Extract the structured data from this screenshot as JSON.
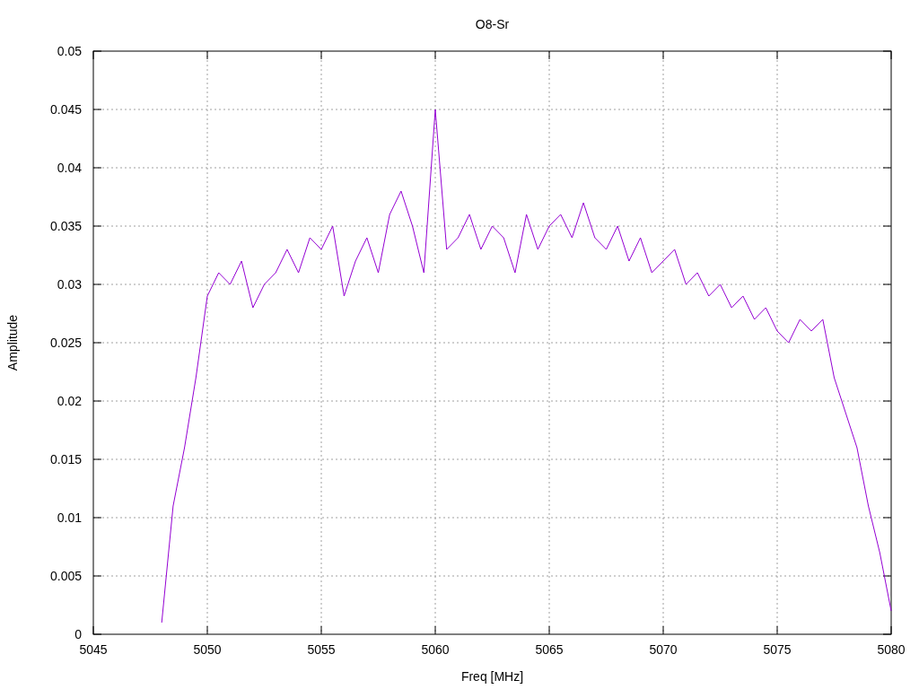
{
  "chart_data": {
    "type": "line",
    "grid": true,
    "title": "O8-Sr",
    "xlabel": "Freq [MHz]",
    "ylabel": "Amplitude",
    "xlim": [
      5045,
      5080
    ],
    "ylim": [
      0,
      0.05
    ],
    "xticks": [
      5045,
      5050,
      5055,
      5060,
      5065,
      5070,
      5075,
      5080
    ],
    "yticks": [
      0,
      0.005,
      0.01,
      0.015,
      0.02,
      0.025,
      0.03,
      0.035,
      0.04,
      0.045,
      0.05
    ],
    "x": [
      5048,
      5048.5,
      5049,
      5049.5,
      5050,
      5050.5,
      5051,
      5051.5,
      5052,
      5052.5,
      5053,
      5053.5,
      5054,
      5054.5,
      5055,
      5055.5,
      5056,
      5056.5,
      5057,
      5057.5,
      5058,
      5058.5,
      5059,
      5059.5,
      5060,
      5060.5,
      5061,
      5061.5,
      5062,
      5062.5,
      5063,
      5063.5,
      5064,
      5064.5,
      5065,
      5065.5,
      5066,
      5066.5,
      5067,
      5067.5,
      5068,
      5068.5,
      5069,
      5069.5,
      5070,
      5070.5,
      5071,
      5071.5,
      5072,
      5072.5,
      5073,
      5073.5,
      5074,
      5074.5,
      5075,
      5075.5,
      5076,
      5076.5,
      5077,
      5077.5,
      5078,
      5078.5,
      5079,
      5079.5,
      5080
    ],
    "series": [
      {
        "color": "#9400d3",
        "values": [
          0.001,
          0.011,
          0.016,
          0.022,
          0.029,
          0.031,
          0.03,
          0.032,
          0.028,
          0.03,
          0.031,
          0.033,
          0.031,
          0.034,
          0.033,
          0.035,
          0.029,
          0.032,
          0.034,
          0.031,
          0.036,
          0.038,
          0.035,
          0.031,
          0.045,
          0.033,
          0.034,
          0.036,
          0.033,
          0.035,
          0.034,
          0.031,
          0.036,
          0.033,
          0.035,
          0.036,
          0.034,
          0.037,
          0.034,
          0.033,
          0.035,
          0.032,
          0.034,
          0.031,
          0.032,
          0.033,
          0.03,
          0.031,
          0.029,
          0.03,
          0.028,
          0.029,
          0.027,
          0.028,
          0.026,
          0.025,
          0.027,
          0.026,
          0.027,
          0.022,
          0.019,
          0.016,
          0.011,
          0.007,
          0.002
        ]
      }
    ]
  }
}
